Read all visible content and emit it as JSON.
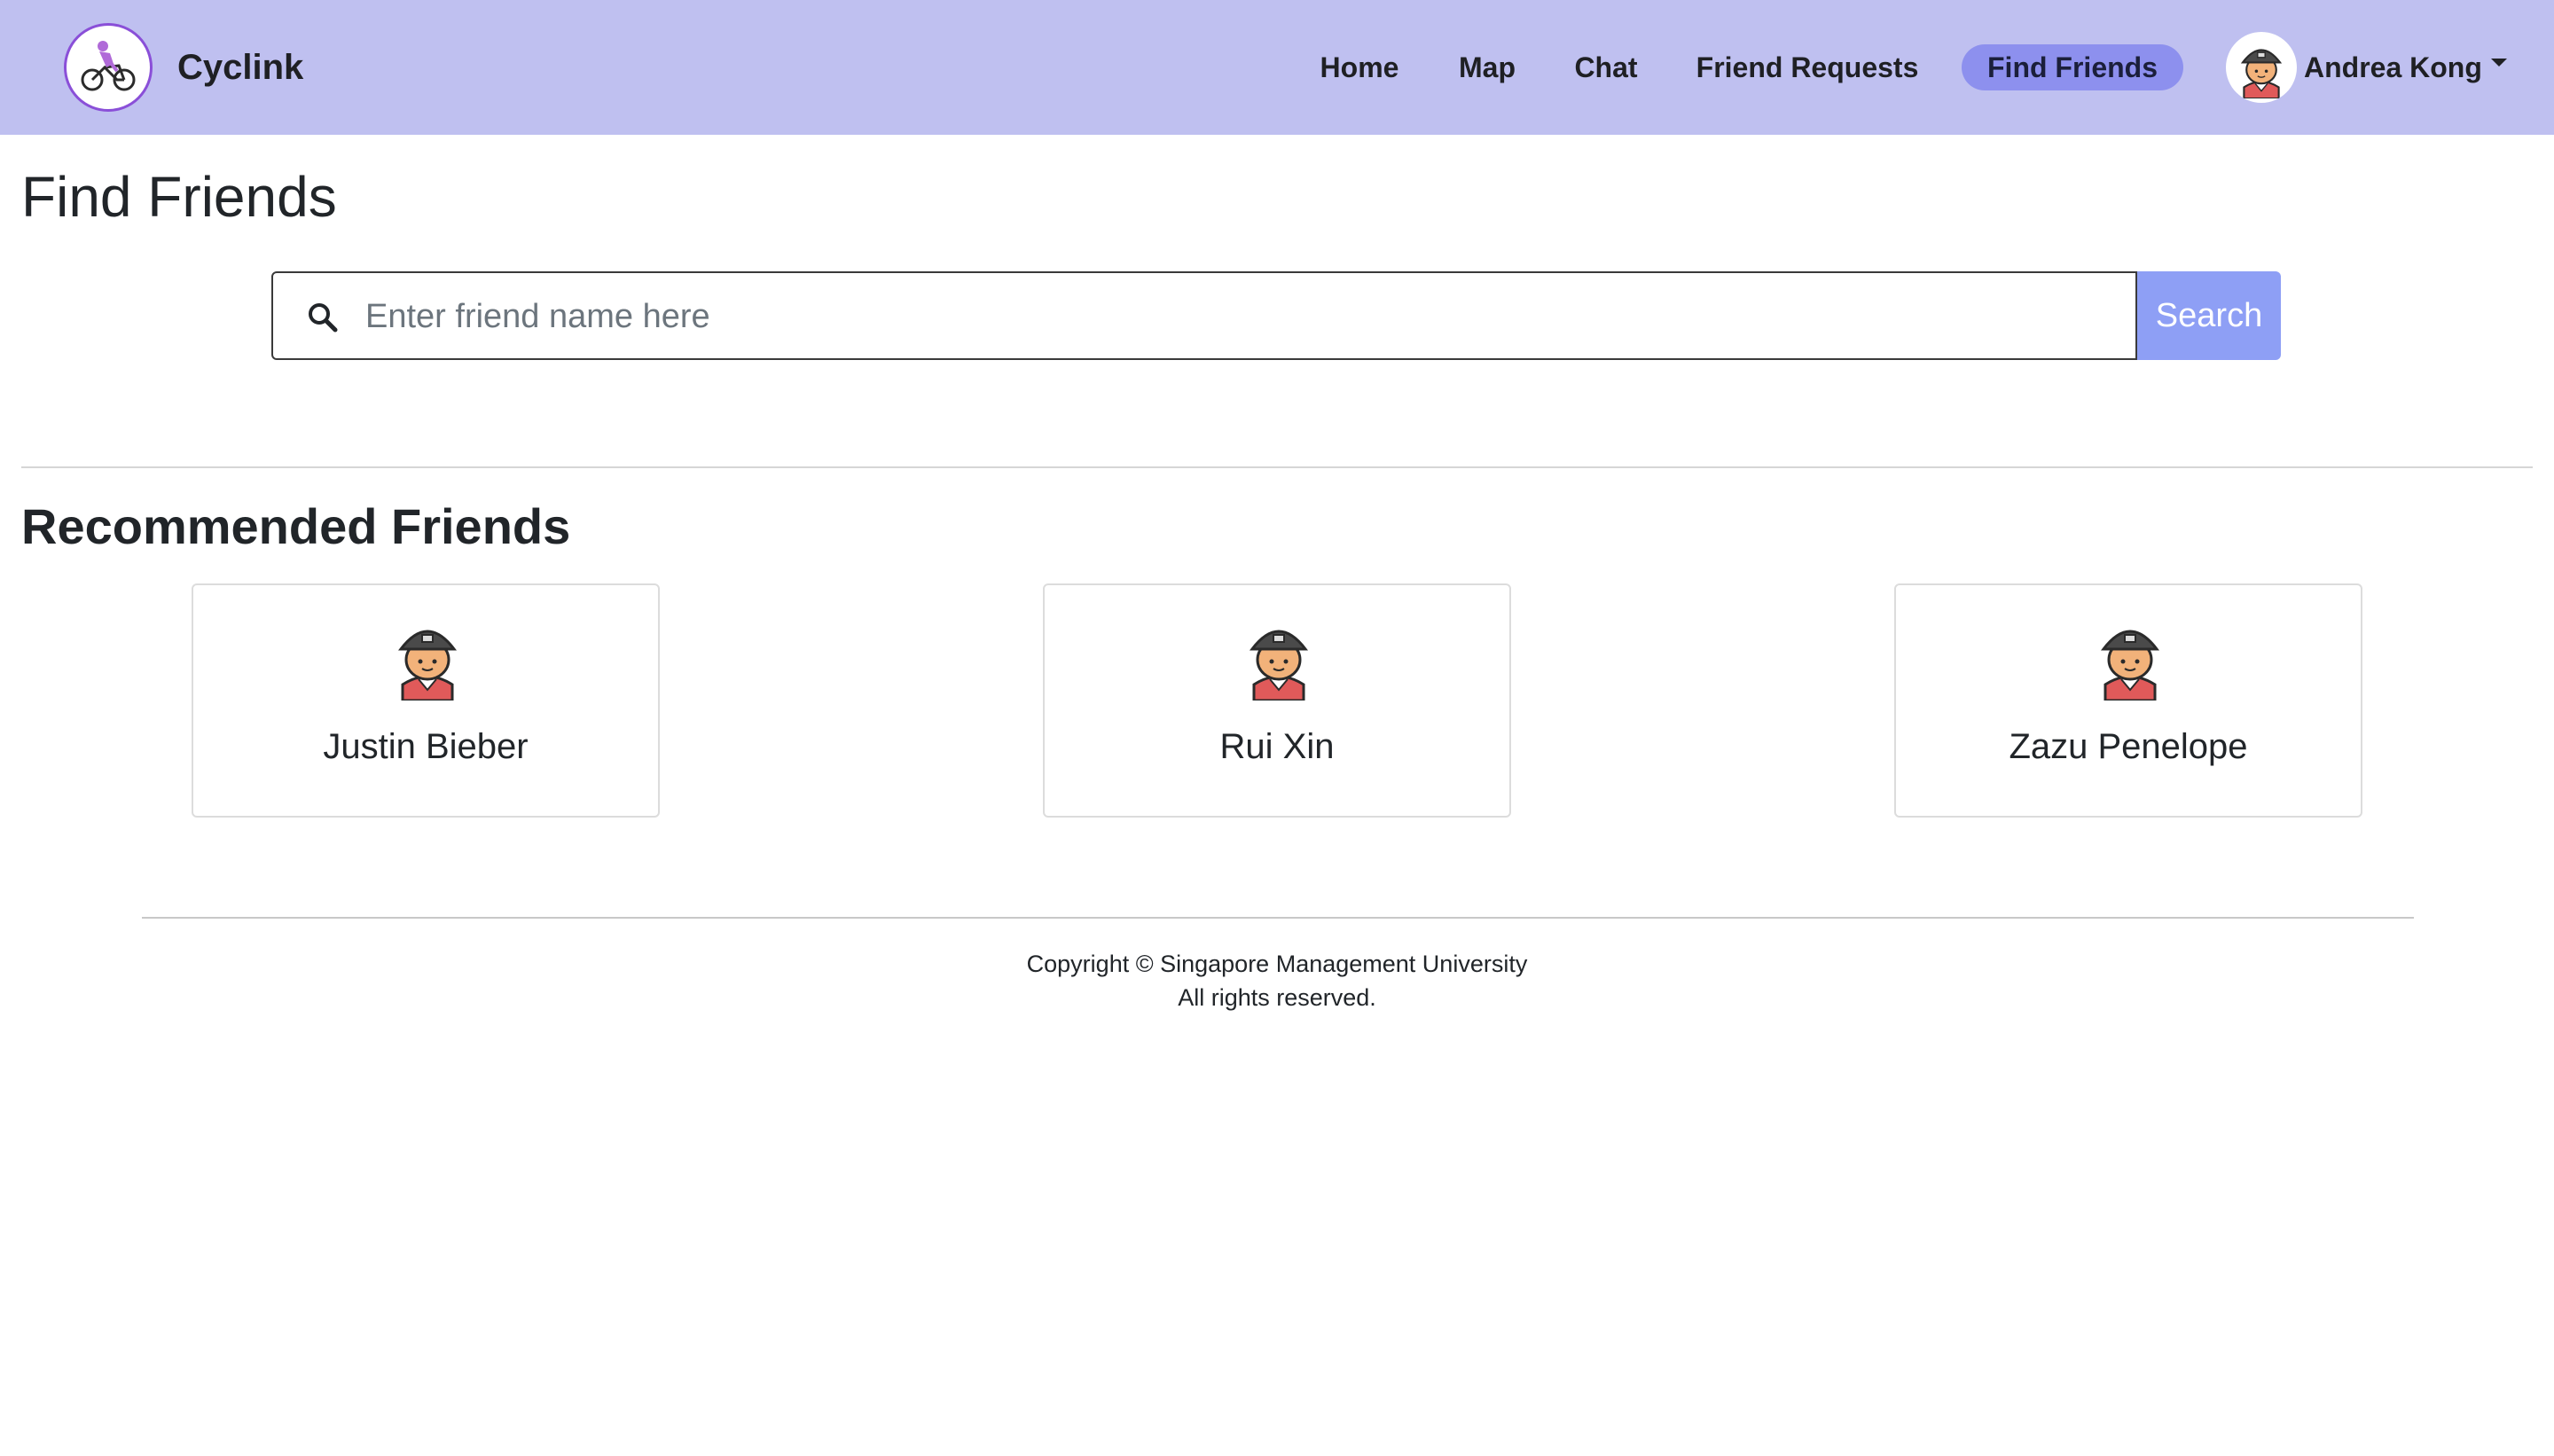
{
  "brand": {
    "name": "Cyclink"
  },
  "nav": {
    "items": [
      {
        "label": "Home",
        "active": false
      },
      {
        "label": "Map",
        "active": false
      },
      {
        "label": "Chat",
        "active": false
      },
      {
        "label": "Friend Requests",
        "active": false
      },
      {
        "label": "Find Friends",
        "active": true
      }
    ]
  },
  "user": {
    "name": "Andrea Kong"
  },
  "page": {
    "title": "Find Friends"
  },
  "search": {
    "placeholder": "Enter friend name here",
    "value": "",
    "button_label": "Search"
  },
  "recommended": {
    "title": "Recommended Friends",
    "friends": [
      {
        "name": "Justin Bieber"
      },
      {
        "name": "Rui Xin"
      },
      {
        "name": "Zazu Penelope"
      }
    ]
  },
  "footer": {
    "line1": "Copyright © Singapore Management University",
    "line2": "All rights reserved."
  },
  "colors": {
    "navbar_bg": "#bfc0f0",
    "active_pill": "#8d90ee",
    "search_button": "#8e9ff5"
  }
}
